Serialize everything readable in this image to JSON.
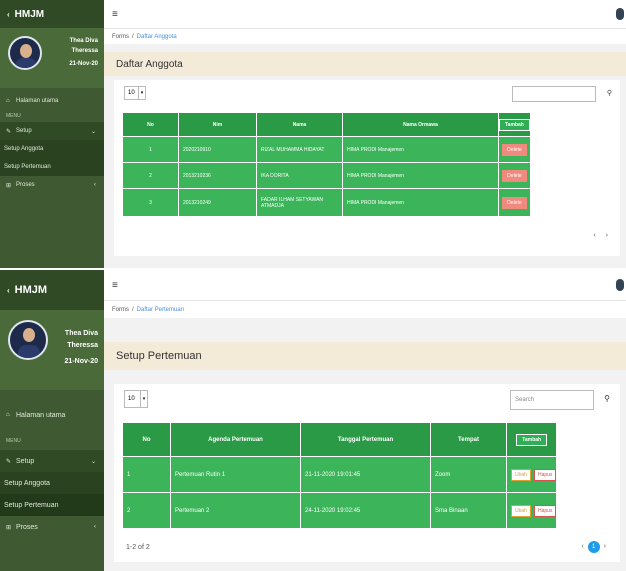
{
  "screen1": {
    "brand": "HMJM",
    "user": {
      "first": "Thea Diva",
      "last": "Theressa",
      "date": "21-Nov-20"
    },
    "nav": {
      "home": "Halaman utama",
      "menu_label": "MENU",
      "setup": "Setup",
      "sub1": "Setup Anggota",
      "sub2": "Setup Pertemuan",
      "proses": "Proses"
    },
    "topbar_icon": "≡",
    "crumb": {
      "root": "Forms",
      "page": "Daftar Anggota"
    },
    "title": "Daftar Anggota",
    "page_size": "10",
    "headers": [
      "No",
      "Nim",
      "Nama",
      "Nama Ormawa"
    ],
    "add_label": "Tambah",
    "rows": [
      {
        "no": "1",
        "nim": "2020210910",
        "nama": "RIZAL MUHAMMA HIDAYAT",
        "ormawa": "HIMA PRODI Manajemen",
        "action": "Delete"
      },
      {
        "no": "2",
        "nim": "2013210236",
        "nama": "IKA DORITA",
        "ormawa": "HIMA PRODI Manajemen",
        "action": "Delete"
      },
      {
        "no": "3",
        "nim": "2013210249",
        "nama": "FADAR ILHAM SETYAWAN ATMADJA",
        "ormawa": "HIMA PRODI Manajemen",
        "action": "Delete"
      }
    ],
    "pager_prev": "‹",
    "pager_next": "›"
  },
  "screen2": {
    "brand": "HMJM",
    "user": {
      "first": "Thea Diva",
      "last": "Theressa",
      "date": "21-Nov-20"
    },
    "nav": {
      "home": "Halaman utama",
      "menu_label": "MENU",
      "setup": "Setup",
      "sub1": "Setup Anggota",
      "sub2": "Setup Pertemuan",
      "proses": "Proses"
    },
    "topbar_icon": "≡",
    "crumb": {
      "root": "Forms",
      "page": "Daftar Pertemuan"
    },
    "title": "Setup Pertemuan",
    "page_size": "10",
    "search_placeholder": "Search",
    "headers": [
      "No",
      "Agenda Pertemuan",
      "Tanggal Pertemuan",
      "Tempat"
    ],
    "add_label": "Tambah",
    "rows": [
      {
        "no": "1",
        "agenda": "Pertemuan Rutin 1",
        "tanggal": "21-11-2020 19:01:45",
        "tempat": "Zoom",
        "ubah": "Ubah",
        "hapus": "Hapus"
      },
      {
        "no": "2",
        "agenda": "Pertemuan 2",
        "tanggal": "24-11-2020 19:02:45",
        "tempat": "Sma Binaan",
        "ubah": "Ubah",
        "hapus": "Hapus"
      }
    ],
    "footer_info": "1-2 of 2",
    "current_page": "1",
    "pager_prev": "‹",
    "pager_next": "›"
  },
  "colors": {
    "sidebar": "#3f5a32",
    "table_header": "#2a9a46",
    "table_row": "#3bb45a",
    "title_bar": "#f3ead8",
    "page_active": "#1e9be9"
  },
  "icons": {
    "search": "search-icon",
    "menu": "hamburger-icon",
    "home": "home-icon",
    "setup": "wrench-icon",
    "proses": "process-icon"
  }
}
